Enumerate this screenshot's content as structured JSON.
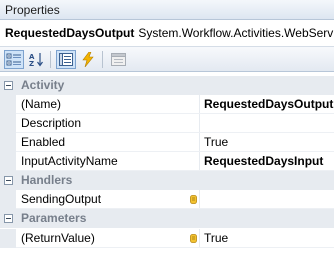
{
  "window": {
    "title": "Properties"
  },
  "object_selector": {
    "name": "RequestedDaysOutput",
    "type": "System.Workflow.Activities.WebServi"
  },
  "toolbar": {
    "buttons": [
      {
        "icon": "categorized-icon",
        "active": true
      },
      {
        "icon": "alphabetical-icon",
        "active": false
      },
      {
        "icon": "properties-icon",
        "active": true
      },
      {
        "icon": "events-icon",
        "active": false
      },
      {
        "icon": "property-pages-icon",
        "active": false
      }
    ]
  },
  "grid": {
    "categories": [
      {
        "label": "Activity",
        "properties": [
          {
            "name": "(Name)",
            "value": "RequestedDaysOutput",
            "bold": true,
            "bindable": false
          },
          {
            "name": "Description",
            "value": "",
            "bold": false,
            "bindable": false
          },
          {
            "name": "Enabled",
            "value": "True",
            "bold": false,
            "bindable": false
          },
          {
            "name": "InputActivityName",
            "value": "RequestedDaysInput",
            "bold": true,
            "bindable": false
          }
        ]
      },
      {
        "label": "Handlers",
        "properties": [
          {
            "name": "SendingOutput",
            "value": "",
            "bold": false,
            "bindable": true
          }
        ]
      },
      {
        "label": "Parameters",
        "properties": [
          {
            "name": "(ReturnValue)",
            "value": "True",
            "bold": false,
            "bindable": true
          }
        ]
      }
    ]
  },
  "colors": {
    "bind_icon": "#e8b51a",
    "category_background": "#e7ebf0",
    "category_text": "#777f8b"
  }
}
